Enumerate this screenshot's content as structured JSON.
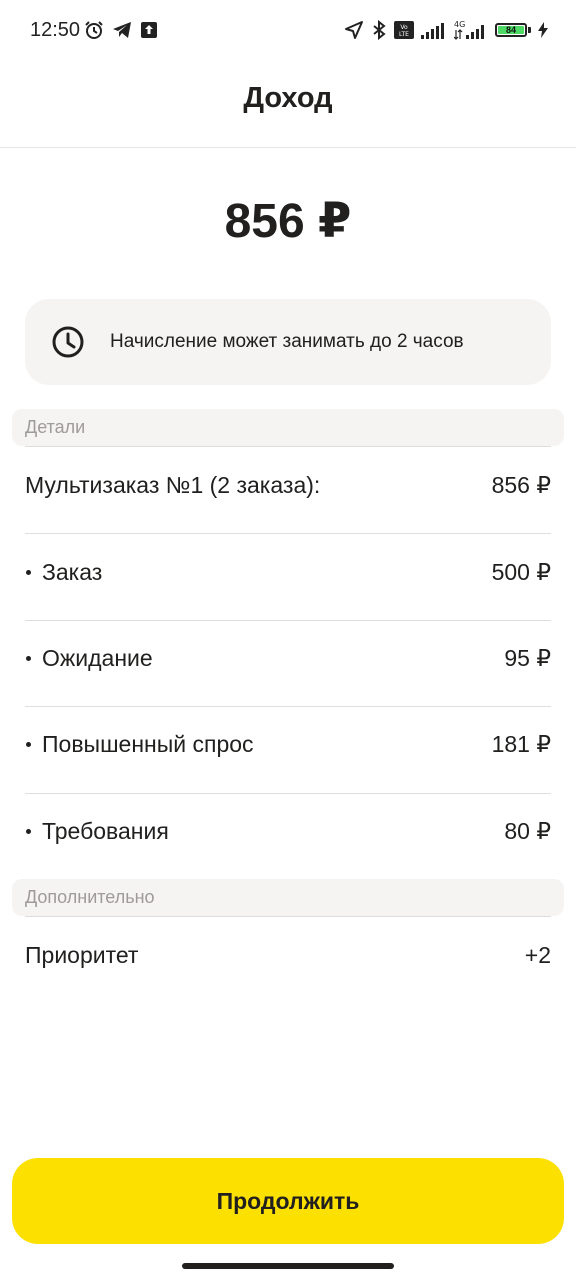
{
  "status_bar": {
    "time": "12:50",
    "battery_level": "84",
    "network": "4G",
    "volte": "Vo LTE"
  },
  "header": {
    "title": "Доход"
  },
  "income": {
    "amount": "856 ₽"
  },
  "notice": {
    "icon": "clock-icon",
    "text": "Начисление может занимать до 2 часов"
  },
  "details": {
    "section_title": "Детали",
    "rows": [
      {
        "label": "Мультизаказ №1 (2 заказа):",
        "value": "856 ₽",
        "bullet": false
      },
      {
        "label": "Заказ",
        "value": "500 ₽",
        "bullet": true
      },
      {
        "label": "Ожидание",
        "value": "95 ₽",
        "bullet": true
      },
      {
        "label": "Повышенный спрос",
        "value": "181 ₽",
        "bullet": true
      },
      {
        "label": "Требования",
        "value": "80 ₽",
        "bullet": true
      }
    ]
  },
  "additional": {
    "section_title": "Дополнительно",
    "rows": [
      {
        "label": "Приоритет",
        "value": "+2"
      }
    ]
  },
  "actions": {
    "continue_label": "Продолжить"
  },
  "colors": {
    "accent_yellow": "#fce000",
    "text_primary": "#21201f",
    "text_secondary": "#9e9b98",
    "surface": "#f5f4f2"
  }
}
